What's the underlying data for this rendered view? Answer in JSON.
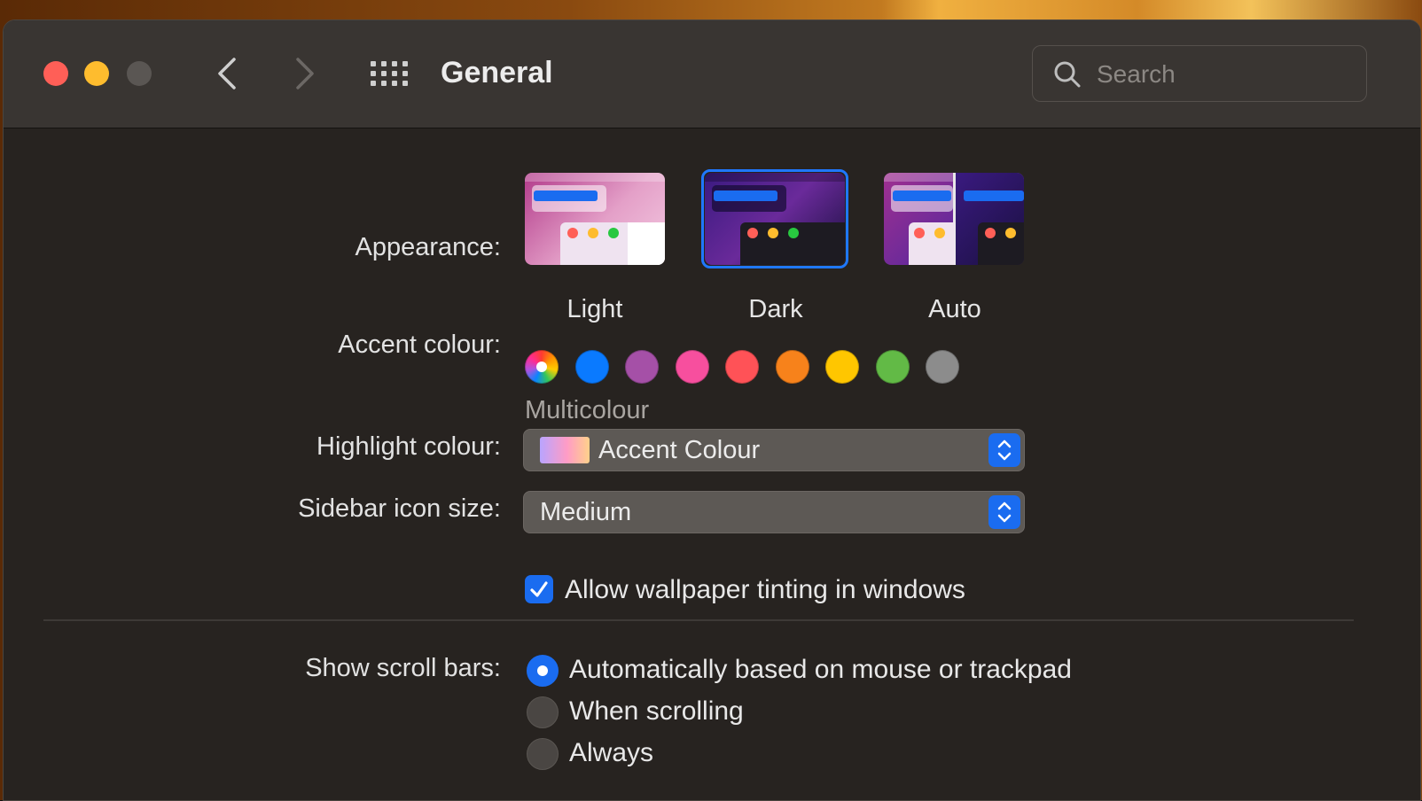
{
  "window": {
    "title": "General",
    "search": {
      "placeholder": "Search"
    }
  },
  "appearance": {
    "label": "Appearance:",
    "options": [
      "Light",
      "Dark",
      "Auto"
    ],
    "selected": "Dark"
  },
  "accent": {
    "label": "Accent colour:",
    "selected_name": "Multicolour",
    "colors": [
      "multicolour",
      "#0a7aff",
      "#a550a7",
      "#f74f9e",
      "#ff5257",
      "#f7821b",
      "#ffc600",
      "#62ba46",
      "#8c8c8c"
    ]
  },
  "highlight": {
    "label": "Highlight colour:",
    "value": "Accent Colour"
  },
  "sidebar_icon_size": {
    "label": "Sidebar icon size:",
    "value": "Medium"
  },
  "wallpaper_tinting": {
    "label": "Allow wallpaper tinting in windows",
    "checked": true
  },
  "scroll_bars": {
    "label": "Show scroll bars:",
    "options": [
      "Automatically based on mouse or trackpad",
      "When scrolling",
      "Always"
    ],
    "selected": "Automatically based on mouse or trackpad"
  }
}
